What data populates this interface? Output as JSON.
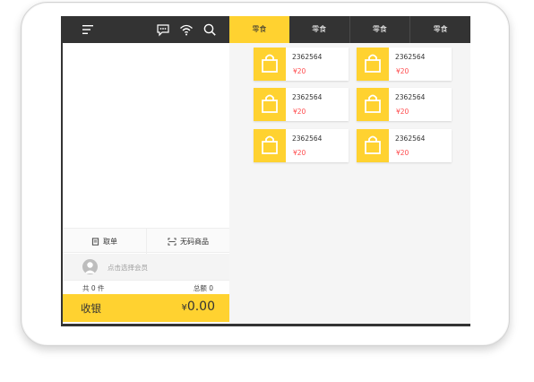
{
  "left": {
    "actions": {
      "take_order": "取单",
      "no_barcode": "无码商品"
    },
    "member_prompt": "点击选择会员",
    "summary": {
      "count": "共 0 件",
      "total": "总额 0"
    },
    "checkout": {
      "label": "收银",
      "currency": "¥",
      "amount": "0.00"
    }
  },
  "tabs": [
    {
      "label": "零食",
      "active": true
    },
    {
      "label": "零食",
      "active": false
    },
    {
      "label": "零食",
      "active": false
    },
    {
      "label": "零食",
      "active": false
    }
  ],
  "products": [
    {
      "code": "2362564",
      "price": "¥20"
    },
    {
      "code": "2362564",
      "price": "¥20"
    },
    {
      "code": "2362564",
      "price": "¥20"
    },
    {
      "code": "2362564",
      "price": "¥20"
    },
    {
      "code": "2362564",
      "price": "¥20"
    },
    {
      "code": "2362564",
      "price": "¥20"
    }
  ],
  "icons": {
    "menu": "menu-icon",
    "chat": "chat-icon",
    "wifi": "wifi-icon",
    "search": "search-icon",
    "bag": "shopping-bag-icon",
    "avatar": "user-avatar-icon"
  },
  "colors": {
    "accent": "#ffd230",
    "dark": "#333333",
    "price": "#ff4d4f"
  }
}
